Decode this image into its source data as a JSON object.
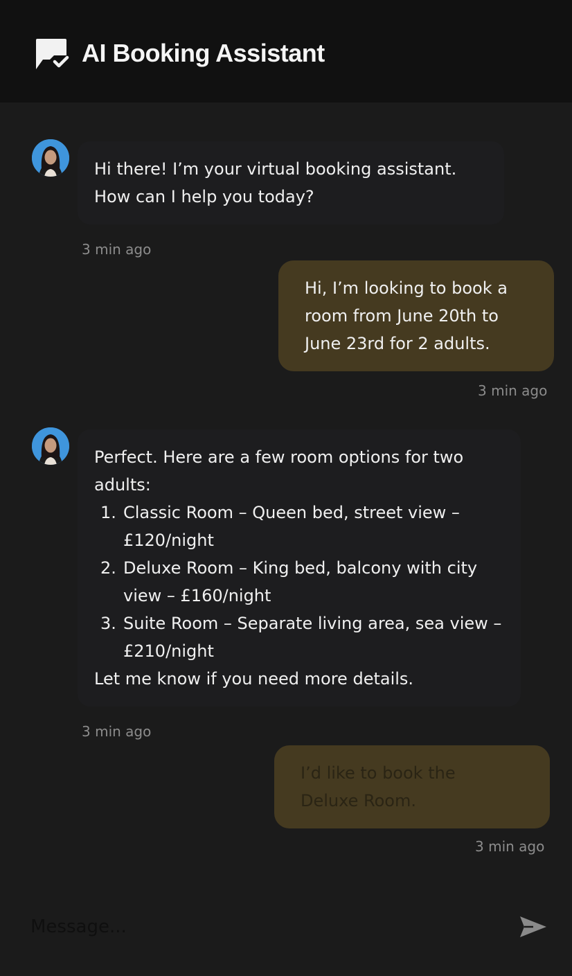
{
  "header": {
    "title": "AI Booking Assistant",
    "icon": "chat-check-icon"
  },
  "messages": [
    {
      "sender": "assistant",
      "avatar": "assistant-avatar",
      "lines": [
        "Hi there! I’m your virtual booking assistant.",
        "How can I help you today?"
      ],
      "time": "3 min ago"
    },
    {
      "sender": "user",
      "lines": [
        "Hi, I’m looking to book a",
        "room from June 20th to",
        "June 23rd for 2 adults."
      ],
      "time": "3 min ago"
    },
    {
      "sender": "assistant",
      "avatar": "assistant-avatar",
      "intro": "Perfect. Here are a few room options for two adults:",
      "options": [
        {
          "num": "1.",
          "text": "Classic Room – Queen bed, street view – £120/night"
        },
        {
          "num": "2.",
          "text": "Deluxe Room – King bed, balcony with city view – £160/night"
        },
        {
          "num": "3.",
          "text": "Suite Room – Separate living area, sea view – £210/night"
        }
      ],
      "outro": "Let me know if you need more details.",
      "time": "3 min ago"
    },
    {
      "sender": "user",
      "lines": [
        "I’d like to book the",
        "Deluxe Room."
      ],
      "time": "3 min ago"
    }
  ],
  "composer": {
    "placeholder": "Message...",
    "send_icon": "send-icon"
  },
  "colors": {
    "background": "#1b1b1b",
    "header": "#111111",
    "assistant_bubble": "#1d1d1f",
    "user_bubble": "#453a20",
    "timestamp": "#8c8c8c"
  }
}
